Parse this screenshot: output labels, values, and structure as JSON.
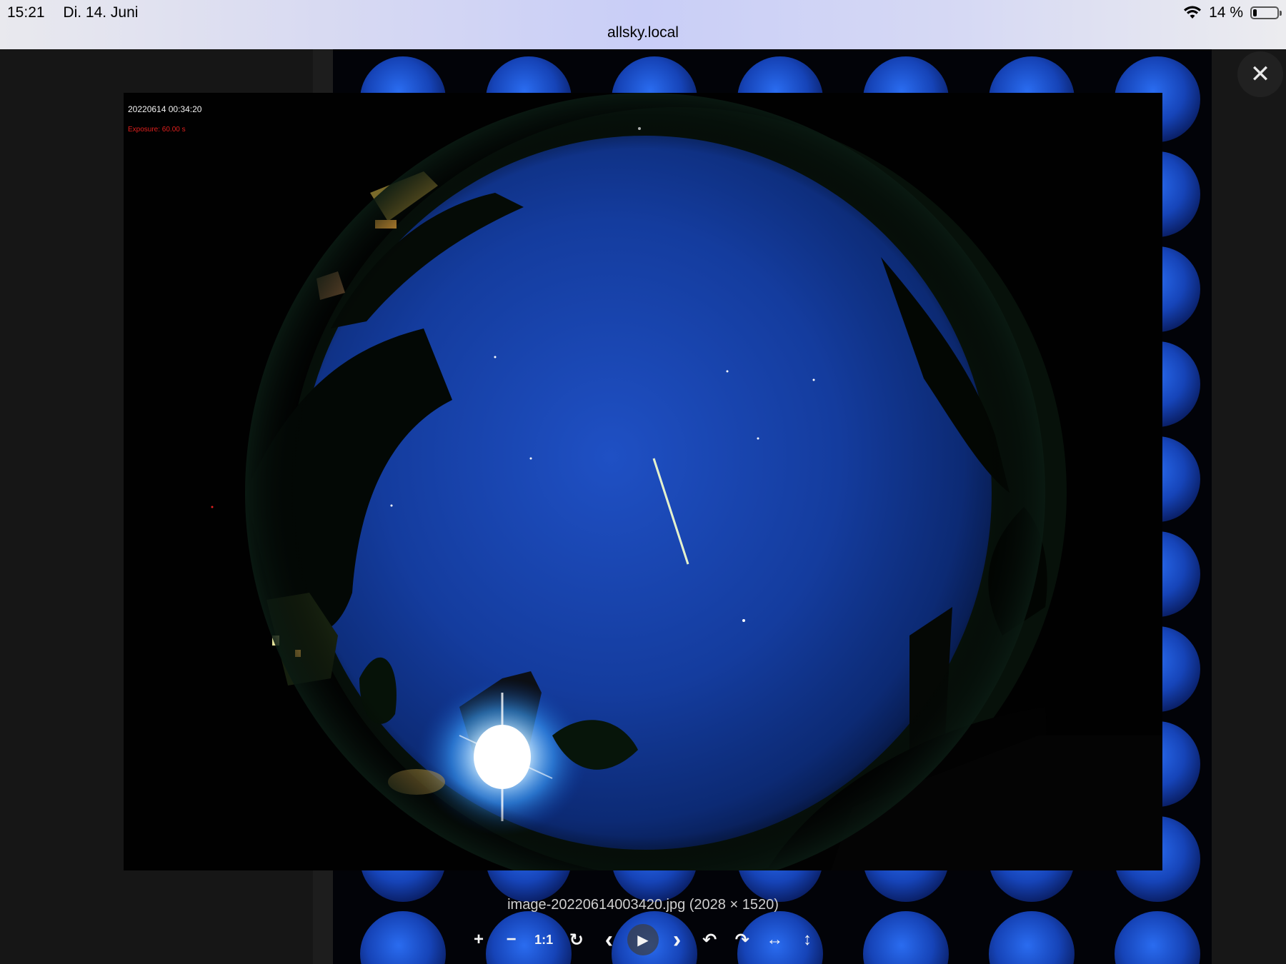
{
  "status_bar": {
    "time": "15:21",
    "date": "Di. 14. Juni",
    "battery": "14 %",
    "battery_level": 0.14
  },
  "browser": {
    "url": "allsky.local"
  },
  "viewer": {
    "overlay_timestamp": "20220614 00:34:20",
    "overlay_exposure": "Exposure: 60.00 s",
    "caption": "image-20220614003420.jpg (2028 × 1520)",
    "close_icon": "close-icon"
  },
  "toolbar": {
    "zoom_in": "+",
    "zoom_out": "−",
    "actual_size": "1:1",
    "reset": "↻",
    "prev": "‹",
    "play": "▶",
    "next": "›",
    "rotate_left": "↶",
    "rotate_right": "↷",
    "flip_horizontal": "↔",
    "flip_vertical": "↕"
  }
}
